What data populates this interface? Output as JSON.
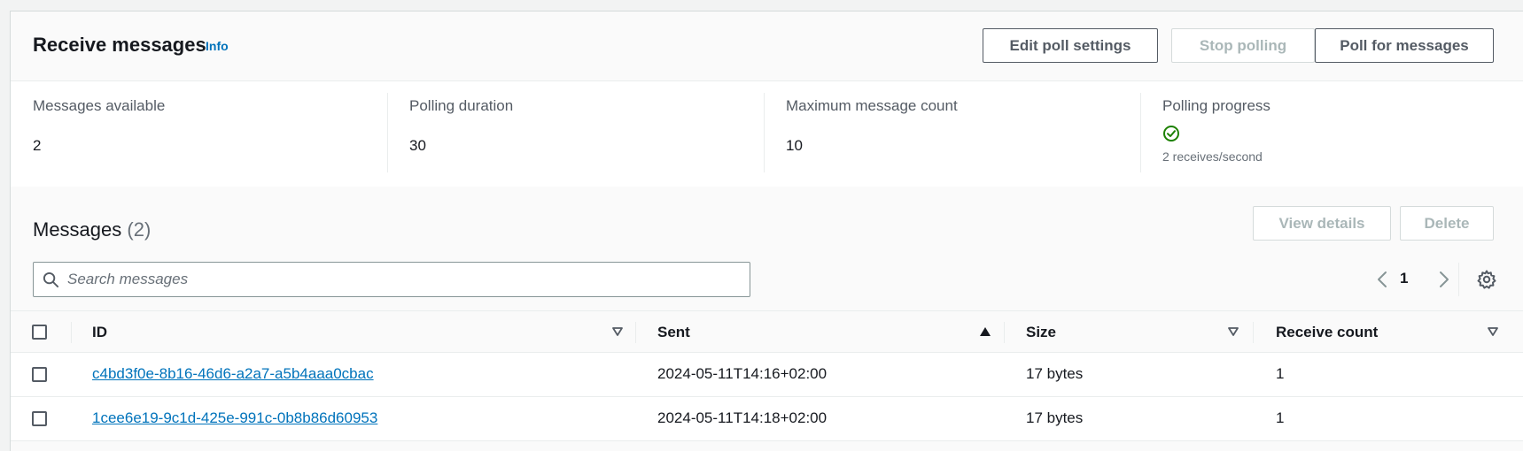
{
  "header": {
    "title": "Receive messages",
    "info_link": "Info",
    "buttons": {
      "edit_poll_settings": "Edit poll settings",
      "stop_polling": "Stop polling",
      "poll_for_messages": "Poll for messages"
    }
  },
  "stats": {
    "messages_available": {
      "label": "Messages available",
      "value": "2"
    },
    "polling_duration": {
      "label": "Polling duration",
      "value": "30"
    },
    "maximum_message_count": {
      "label": "Maximum message count",
      "value": "10"
    },
    "polling_progress": {
      "label": "Polling progress",
      "status_icon": "check-circle-icon",
      "detail": "2 receives/second"
    }
  },
  "messages": {
    "title": "Messages",
    "count": "(2)",
    "buttons": {
      "view_details": "View details",
      "delete": "Delete"
    },
    "search": {
      "placeholder": "Search messages",
      "value": ""
    },
    "pagination": {
      "current_page": "1"
    },
    "table": {
      "columns": {
        "id": "ID",
        "sent": "Sent",
        "size": "Size",
        "receive_count": "Receive count"
      },
      "sorted_by": "Sent",
      "sort_direction": "ascending",
      "rows": [
        {
          "id": "c4bd3f0e-8b16-46d6-a2a7-a5b4aaa0cbac",
          "sent": "2024-05-11T14:16+02:00",
          "size": "17 bytes",
          "receive_count": "1"
        },
        {
          "id": "1cee6e19-9c1d-425e-991c-0b8b86d60953",
          "sent": "2024-05-11T14:18+02:00",
          "size": "17 bytes",
          "receive_count": "1"
        }
      ]
    }
  },
  "colors": {
    "link": "#0073bb",
    "success": "#1d8102",
    "text": "#16191f",
    "muted": "#687078",
    "disabled": "#aab7b8"
  }
}
